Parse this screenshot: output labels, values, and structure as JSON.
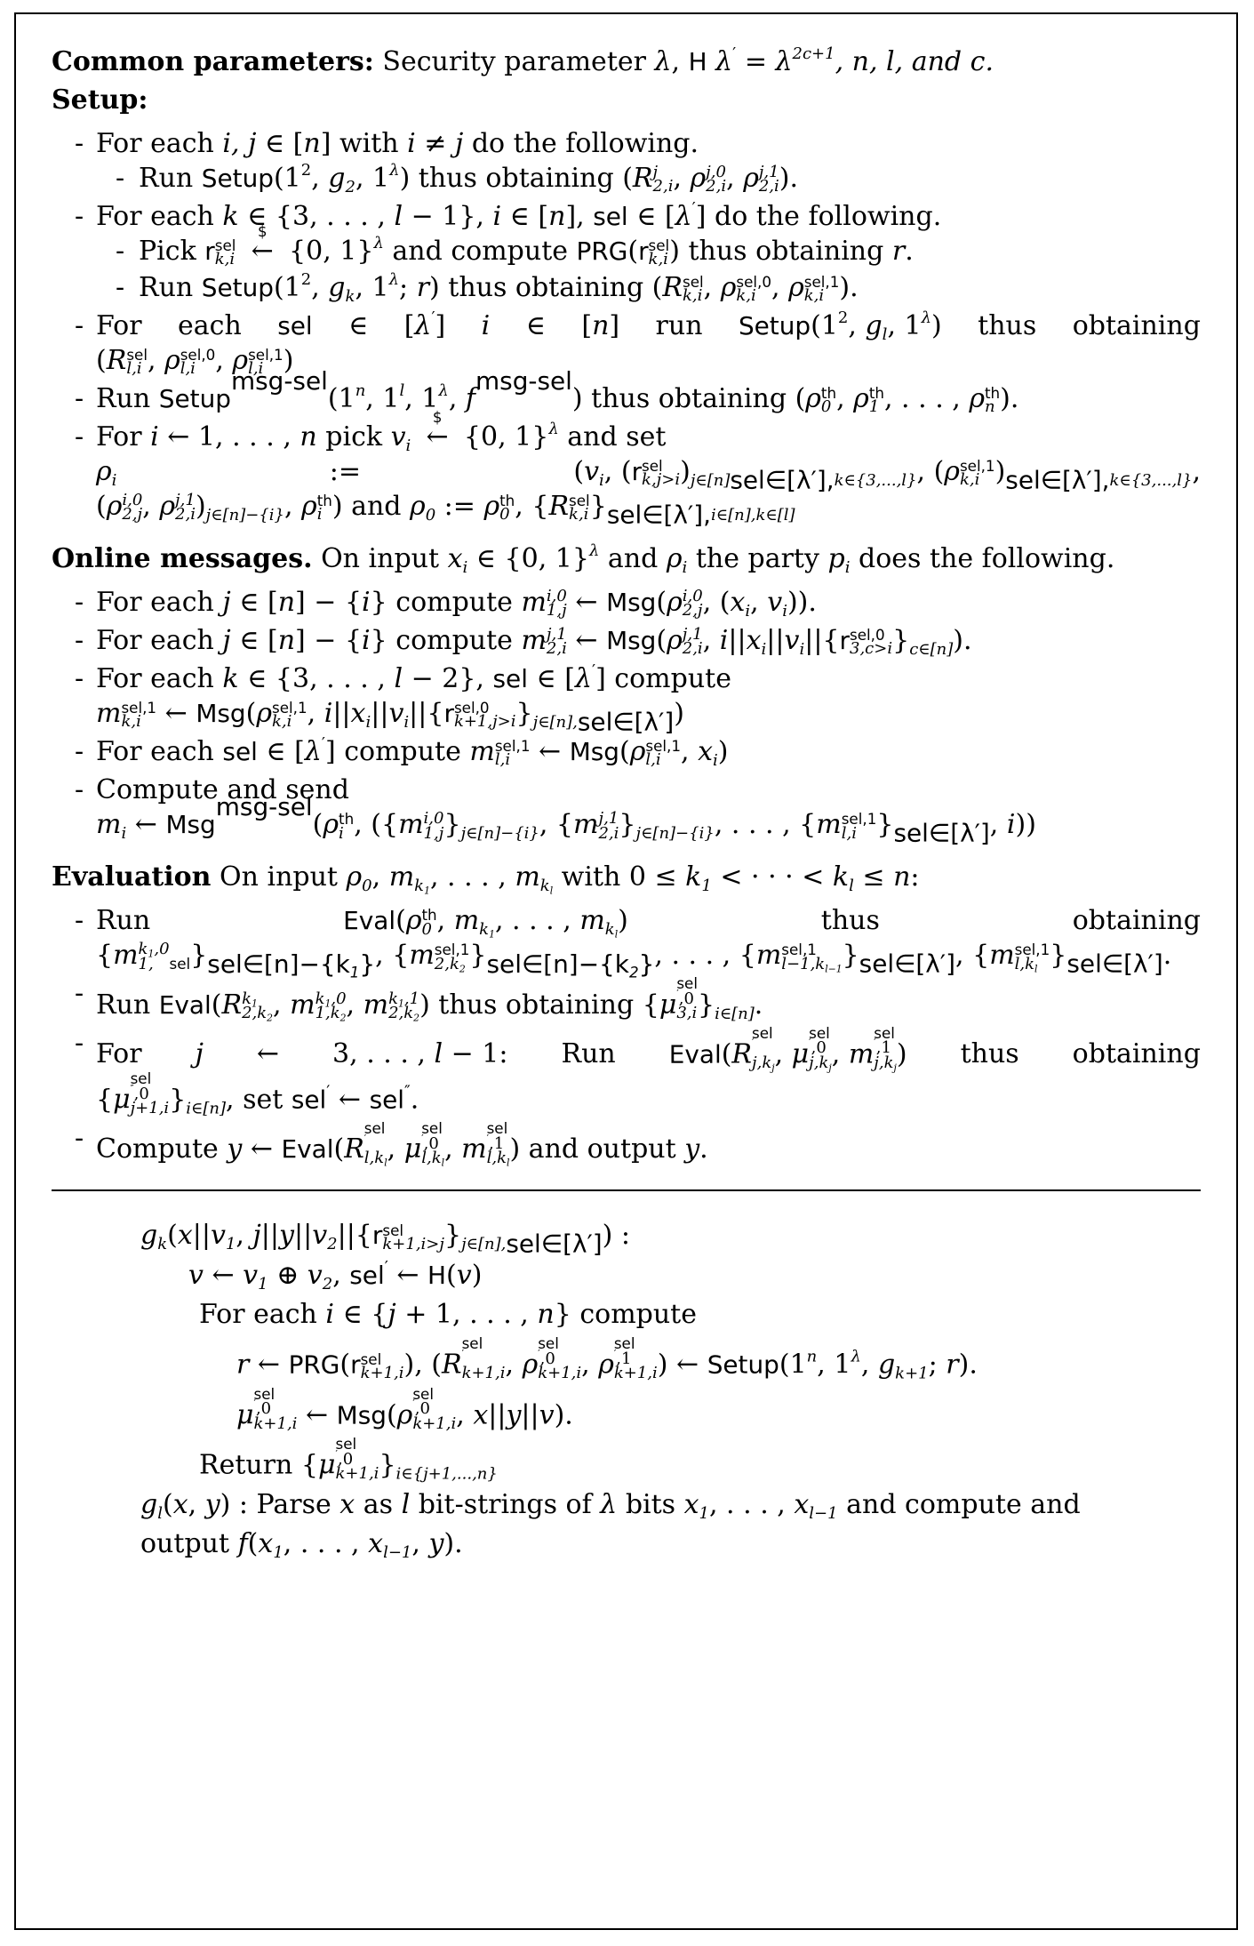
{
  "document": {
    "type": "cryptographic-protocol-figure",
    "sections": [
      {
        "id": "common-parameters",
        "heading": "Common parameters:",
        "text": "Security parameter λ, H λ′ = λ2c+1, n, l, and c."
      },
      {
        "id": "setup",
        "heading": "Setup:"
      },
      {
        "id": "online-messages",
        "heading": "Online messages.",
        "text": "On input xi ∈ {0,1}λ and ρi the party pi does the following."
      },
      {
        "id": "evaluation",
        "heading": "Evaluation",
        "text": "On input ρ0, mk1 , . . . , mkl with 0 ≤ k1 < · · · < kl ≤ n:"
      }
    ]
  },
  "common_parameters": {
    "label": "Common parameters:",
    "body_prefix": "Security parameter",
    "lambda": "λ",
    "comma": ",",
    "H": "H",
    "lambda_prime": "λ",
    "prime": "′",
    "equals": "=",
    "lambda2": "λ",
    "exp_2c1": "2c+1",
    "tail": ", n, l, and c."
  },
  "setup": {
    "label": "Setup:",
    "items": [
      {
        "id": "setup-item-1",
        "text": "For each i, j ∈ [n] with i ≠ j do the following.",
        "sub": [
          {
            "id": "setup-item-1-sub-1",
            "text": "Run Setup(12, g2, 1λ) thus obtaining (Rj2,i, ρj,02,i, ρj,12,i)."
          }
        ]
      },
      {
        "id": "setup-item-2",
        "text": "For each k ∈ {3, . . . , l − 1}, i ∈ [n], sel ∈ [λ′] do the following.",
        "sub": [
          {
            "id": "setup-item-2-sub-1",
            "text": "Pick rselk,i ←$ {0,1}λ and compute PRG(rselk,i) thus obtaining r."
          },
          {
            "id": "setup-item-2-sub-2",
            "text": "Run Setup(12, gk, 1λ; r) thus obtaining (Rselk,i, ρsel,0k,i, ρsel,1k,i)."
          }
        ]
      },
      {
        "id": "setup-item-3",
        "text": "For each sel ∈ [λ′] i ∈ [n] run Setup(12, gl, 1λ) thus obtaining (Rsell,i, ρsel,0l,i, ρsel,1l,i)"
      },
      {
        "id": "setup-item-4",
        "text": "Run Setupmsg-sel(1n, 1l, 1λ, fmsg-sel) thus obtaining (ρth0, ρth1, . . . , ρthn)."
      },
      {
        "id": "setup-item-5",
        "text": "For i ← 1, . . . , n pick vi ←$ {0,1}λ and set ρi := (vi, (rselk,j>i)j∈[n]sel∈[λ′],k∈{3,...,l}, (ρsel,1k,i)sel∈[λ′],k∈{3,...,l}, (ρi,02,j, ρj,12,i)j∈[n]−{i}, ρthi) and ρ0 := ρth0, {Rselk,i}sel∈[λ′],i∈[n],k∈[l]"
      }
    ]
  },
  "online": {
    "label": "Online messages.",
    "intro_tail": "On input xi ∈ {0,1}λ and ρi the party pi does the following.",
    "items": [
      {
        "id": "online-item-1",
        "text": "For each j ∈ [n] − {i} compute mi,01,j ← Msg(ρi,02,j, (xi, vi))."
      },
      {
        "id": "online-item-2",
        "text": "For each j ∈ [n] − {i} compute mj,12,i ← Msg(ρj,12,i, i||xi||vi||{rsel,03,c>i}c∈[n])."
      },
      {
        "id": "online-item-3",
        "text": "For each k ∈ {3, . . . , l − 2}, sel ∈ [λ′] compute msel,1k,i ← Msg(ρsel,1k,i, i||xi||vi||{rsel,0k+1,j>i}j∈[n],sel∈[λ′])"
      },
      {
        "id": "online-item-4",
        "text": "For each sel ∈ [λ′] compute msel,1l,i ← Msg(ρsel,1l,i, xi)"
      },
      {
        "id": "online-item-5",
        "text": "Compute and send mi ← Msgmsg-sel(ρthi, ({mi,01,j}j∈[n]−{i}, {mj,12,i}j∈[n]−{i}, . . . , {msel,1l,i}sel∈[λ′], i))"
      }
    ]
  },
  "evaluation": {
    "label": "Evaluation",
    "intro_tail": "On input ρ0, mk1 , . . . , mkl with 0 ≤ k1 < · · · < kl ≤ n:",
    "items": [
      {
        "id": "eval-item-1",
        "text": "Run Eval(ρth0, mk1, . . . , mkl) thus obtaining {mk1,01,sel}sel∈[n]−{k1}, {msel,12,k2}sel∈[n]−{k2}, . . . , {msel,1l−1,kl−1}sel∈[λ′], {msel,1l,kl}sel∈[λ′]."
      },
      {
        "id": "eval-item-2",
        "text": "Run Eval(Rk12,k2, mk1,01,k2, mk1,12,k2) thus obtaining {μsel′,03,i}i∈[n]."
      },
      {
        "id": "eval-item-3",
        "text": "For j ← 3, . . . , l − 1: Run Eval(Rsel′j,kj, μsel′,0j,kj, msel′,1j,kj) thus obtaining {μsel″,0j+1,i}i∈[n], set sel′ ← sel″."
      },
      {
        "id": "eval-item-4",
        "text": "Compute y ← Eval(Rsel′l,kl, μsel′,0l,kl, msel′,1l,kl) and output y."
      }
    ]
  },
  "functions": {
    "gk": {
      "signature": "gk(x||v1, j||y||v2||{rselk+1,i>j}j∈[n],sel∈[λ′]) :",
      "lines": [
        "v ← v1 ⊕ v2, sel′ ← H(v)",
        "For each i ∈ {j + 1, . . . , n} compute",
        "r ← PRG(rselk+1,i), (Rsel′k+1,i, ρsel′,0k+1,i, ρsel′,1k+1,i) ← Setup(1n, 1λ, gk+1; r).",
        "μsel′,0k+1,i ← Msg(ρsel′,0k+1,i, x||y||v).",
        "Return {μsel′,0k+1,i}i∈{j+1,...,n}"
      ]
    },
    "gl": {
      "signature": "gl(x, y) :",
      "text": "Parse x as l bit-strings of λ bits x1, . . . , xl−1 and compute and output f(x1, . . . , xl−1, y)."
    }
  },
  "symbols": {
    "dash_bullet": "-",
    "dollar": "$",
    "arrow_left": "←",
    "in": "∈",
    "neq": "≠",
    "leq": "≤",
    "lt": "<",
    "oplus": "⊕",
    "cdots": "· · ·",
    "ldots": ". . .",
    "assign": ":=",
    "colon": ":"
  },
  "colors": {
    "text": "#000000",
    "background": "#ffffff",
    "border": "#000000"
  }
}
